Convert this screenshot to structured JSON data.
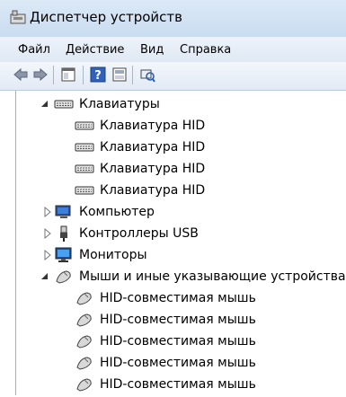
{
  "window": {
    "title": "Диспетчер устройств"
  },
  "menu": {
    "file": "Файл",
    "action": "Действие",
    "view": "Вид",
    "help": "Справка"
  },
  "toolbar_icons": [
    "back-arrow-icon",
    "forward-arrow-icon",
    "properties-panel-icon",
    "help-icon",
    "device-panel-icon",
    "scan-hardware-icon"
  ],
  "tree": {
    "keyboards": {
      "label": "Клавиатуры",
      "children": [
        "Клавиатура HID",
        "Клавиатура HID",
        "Клавиатура HID",
        "Клавиатура HID"
      ]
    },
    "computer": {
      "label": "Компьютер"
    },
    "usb": {
      "label": "Контроллеры USB"
    },
    "monitors": {
      "label": "Мониторы"
    },
    "mice": {
      "label": "Мыши и иные указывающие устройства",
      "children": [
        "HID-совместимая мышь",
        "HID-совместимая мышь",
        "HID-совместимая мышь",
        "HID-совместимая мышь",
        "HID-совместимая мышь"
      ]
    }
  }
}
